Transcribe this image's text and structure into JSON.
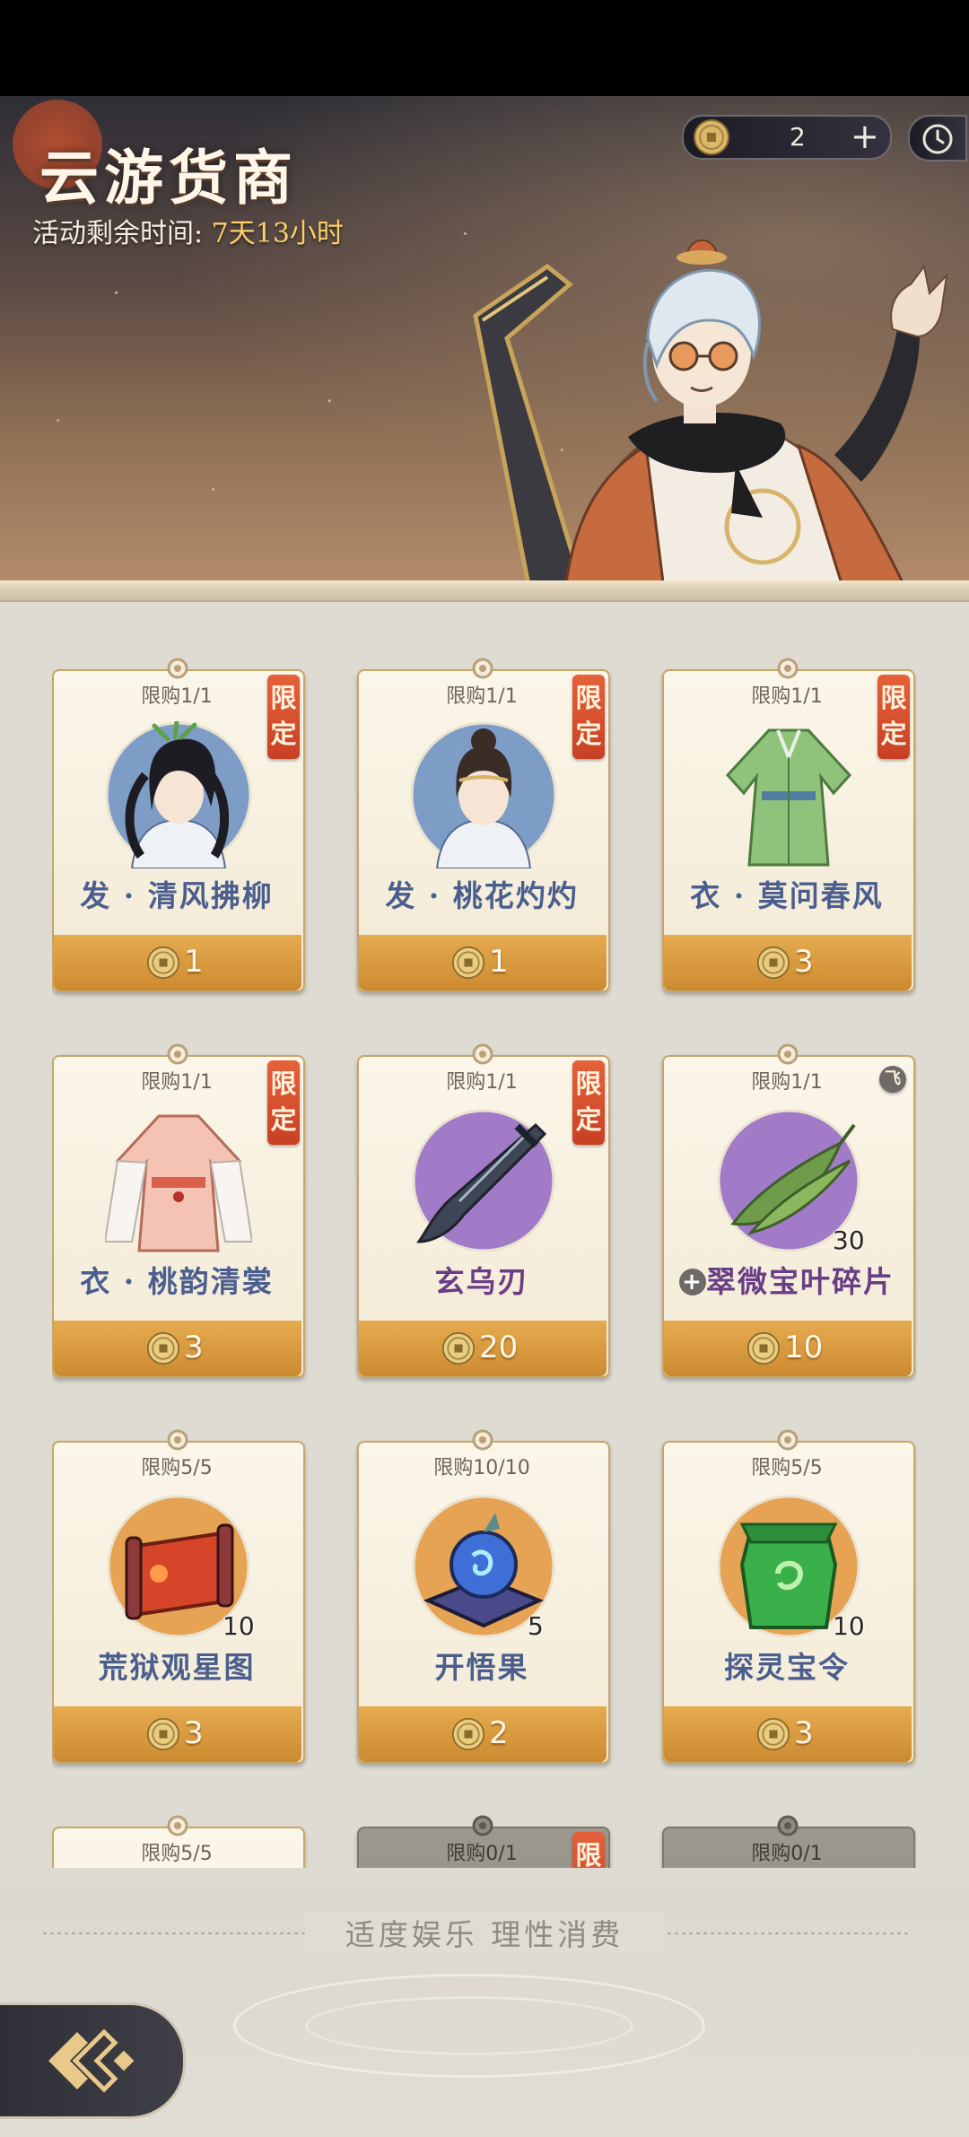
{
  "header": {
    "title": "云游货商",
    "timer_label": "活动剩余时间:",
    "timer_value": "7天13小时",
    "currency_amount": "2",
    "add_symbol": "+"
  },
  "colors": {
    "accent_gold": "#d89a3c",
    "limited_red": "#d64a2c",
    "name_blue": "#4b5f8f",
    "name_purple": "#6a3e86"
  },
  "items": [
    {
      "limit": "限购1/1",
      "tag": "限定",
      "name": "发 · 清风拂柳",
      "price": "1",
      "count": "",
      "art": "hair-green-icon"
    },
    {
      "limit": "限购1/1",
      "tag": "限定",
      "name": "发 · 桃花灼灼",
      "price": "1",
      "count": "",
      "art": "hair-bun-icon"
    },
    {
      "limit": "限购1/1",
      "tag": "限定",
      "name": "衣 · 莫问春风",
      "price": "3",
      "count": "",
      "art": "robe-green-icon"
    },
    {
      "limit": "限购1/1",
      "tag": "限定",
      "name": "衣 · 桃韵清裳",
      "price": "3",
      "count": "",
      "art": "robe-pink-icon"
    },
    {
      "limit": "限购1/1",
      "tag": "限定",
      "name": "玄乌刃",
      "price": "20",
      "count": "",
      "art": "blade-icon"
    },
    {
      "limit": "限购1/1",
      "tag": "飞",
      "name": "翠微宝叶碎片",
      "price": "10",
      "count": "30",
      "art": "leaf-icon"
    },
    {
      "limit": "限购5/5",
      "tag": "",
      "name": "荒狱观星图",
      "price": "3",
      "count": "10",
      "art": "scroll-map-icon"
    },
    {
      "limit": "限购10/10",
      "tag": "",
      "name": "开悟果",
      "price": "2",
      "count": "5",
      "art": "orb-fruit-icon"
    },
    {
      "limit": "限购5/5",
      "tag": "",
      "name": "探灵宝令",
      "price": "3",
      "count": "10",
      "art": "jade-token-icon"
    },
    {
      "limit": "限购5/5",
      "tag": "",
      "name": "",
      "price": "",
      "count": "",
      "art": ""
    },
    {
      "limit": "限购0/1",
      "tag": "限定",
      "name": "",
      "price": "",
      "count": "",
      "art": ""
    },
    {
      "limit": "限购0/1",
      "tag": "",
      "name": "",
      "price": "",
      "count": "",
      "art": ""
    }
  ],
  "footer": {
    "slogan": "适度娱乐 理性消费"
  }
}
